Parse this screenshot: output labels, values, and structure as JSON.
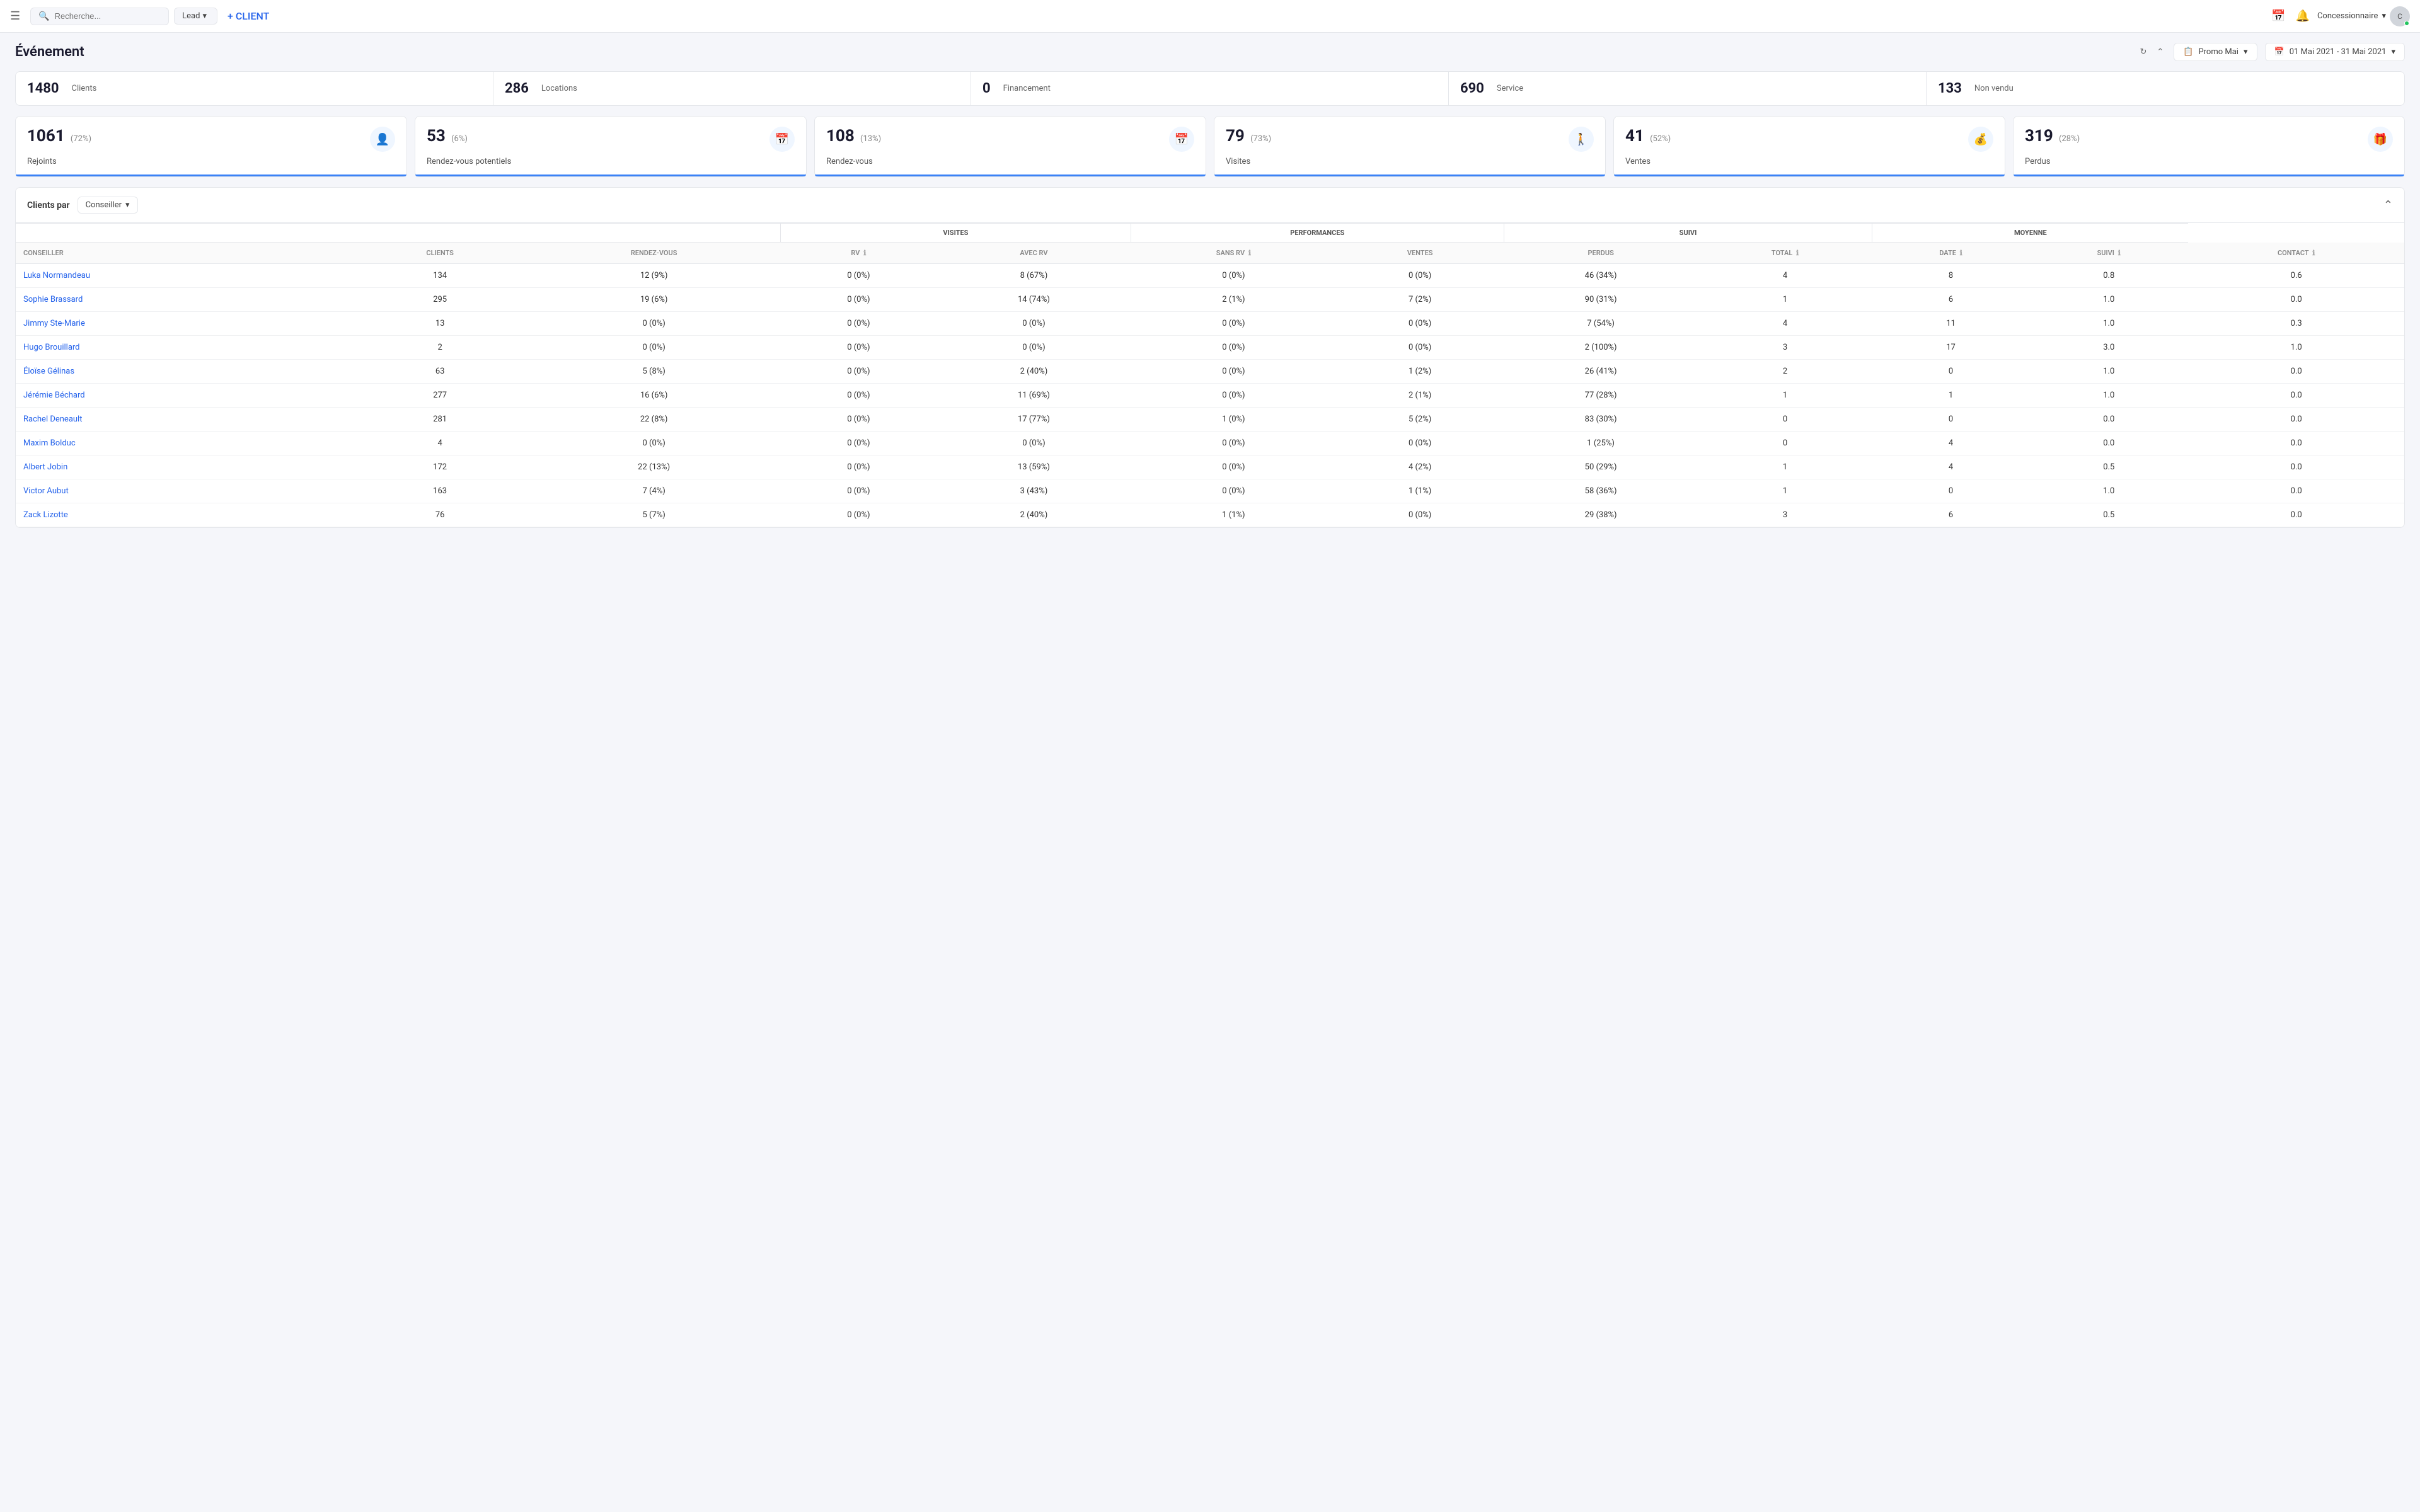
{
  "navbar": {
    "menu_label": "☰",
    "search_placeholder": "Recherche...",
    "lead_label": "Lead",
    "add_client_label": "+ CLIENT",
    "calendar_icon": "📅",
    "bell_icon": "🔔",
    "user_name": "Concessionnaire",
    "avatar_initials": "C"
  },
  "page": {
    "title": "Événement",
    "promo_label": "Promo Mai",
    "date_range": "01 Mai 2021 - 31 Mai 2021"
  },
  "stat_cards": [
    {
      "number": "1480",
      "label": "Clients"
    },
    {
      "number": "286",
      "label": "Locations"
    },
    {
      "number": "0",
      "label": "Financement"
    },
    {
      "number": "690",
      "label": "Service"
    },
    {
      "number": "133",
      "label": "Non vendu"
    }
  ],
  "metric_cards": [
    {
      "value": "1061",
      "pct": "(72%)",
      "label": "Rejoints",
      "icon": "👤"
    },
    {
      "value": "53",
      "pct": "(6%)",
      "label": "Rendez-vous potentiels",
      "icon": "📅"
    },
    {
      "value": "108",
      "pct": "(13%)",
      "label": "Rendez-vous",
      "icon": "📅"
    },
    {
      "value": "79",
      "pct": "(73%)",
      "label": "Visites",
      "icon": "🚶"
    },
    {
      "value": "41",
      "pct": "(52%)",
      "label": "Ventes",
      "icon": "💰"
    },
    {
      "value": "319",
      "pct": "(28%)",
      "label": "Perdus",
      "icon": "🎁"
    }
  ],
  "table": {
    "title": "Clients par",
    "filter_label": "Conseiller",
    "col_groups": [
      {
        "label": "",
        "colspan": 3
      },
      {
        "label": "VISITES",
        "colspan": 2
      },
      {
        "label": "PERFORMANCES",
        "colspan": 2
      },
      {
        "label": "SUIVI",
        "colspan": 2
      },
      {
        "label": "MOYENNE",
        "colspan": 2
      }
    ],
    "columns": [
      "Conseiller",
      "Clients",
      "Rendez-vous",
      "RV",
      "Avec RV",
      "Sans RV",
      "Ventes",
      "Perdus",
      "Total",
      "Date",
      "Suivi",
      "Contact"
    ],
    "rows": [
      {
        "name": "Luka Normandeau",
        "clients": 134,
        "rdv": "12 (9%)",
        "rv": "0 (0%)",
        "avec_rv": "8 (67%)",
        "sans_rv": "0 (0%)",
        "ventes": "0 (0%)",
        "perdus": "46 (34%)",
        "total": 4,
        "date": 8,
        "suivi": "0.8",
        "contact": "0.6"
      },
      {
        "name": "Sophie Brassard",
        "clients": 295,
        "rdv": "19 (6%)",
        "rv": "0 (0%)",
        "avec_rv": "14 (74%)",
        "sans_rv": "2 (1%)",
        "ventes": "7 (2%)",
        "perdus": "90 (31%)",
        "total": 1,
        "date": 6,
        "suivi": "1.0",
        "contact": "0.0"
      },
      {
        "name": "Jimmy Ste-Marie",
        "clients": 13,
        "rdv": "0 (0%)",
        "rv": "0 (0%)",
        "avec_rv": "0 (0%)",
        "sans_rv": "0 (0%)",
        "ventes": "0 (0%)",
        "perdus": "7 (54%)",
        "total": 4,
        "date": 11,
        "suivi": "1.0",
        "contact": "0.3"
      },
      {
        "name": "Hugo Brouillard",
        "clients": 2,
        "rdv": "0 (0%)",
        "rv": "0 (0%)",
        "avec_rv": "0 (0%)",
        "sans_rv": "0 (0%)",
        "ventes": "0 (0%)",
        "perdus": "2 (100%)",
        "total": 3,
        "date": 17,
        "suivi": "3.0",
        "contact": "1.0"
      },
      {
        "name": "Éloïse Gélinas",
        "clients": 63,
        "rdv": "5 (8%)",
        "rv": "0 (0%)",
        "avec_rv": "2 (40%)",
        "sans_rv": "0 (0%)",
        "ventes": "1 (2%)",
        "perdus": "26 (41%)",
        "total": 2,
        "date": 0,
        "suivi": "1.0",
        "contact": "0.0"
      },
      {
        "name": "Jérémie Béchard",
        "clients": 277,
        "rdv": "16 (6%)",
        "rv": "0 (0%)",
        "avec_rv": "11 (69%)",
        "sans_rv": "0 (0%)",
        "ventes": "2 (1%)",
        "perdus": "77 (28%)",
        "total": 1,
        "date": 1,
        "suivi": "1.0",
        "contact": "0.0"
      },
      {
        "name": "Rachel Deneault",
        "clients": 281,
        "rdv": "22 (8%)",
        "rv": "0 (0%)",
        "avec_rv": "17 (77%)",
        "sans_rv": "1 (0%)",
        "ventes": "5 (2%)",
        "perdus": "83 (30%)",
        "total": 0,
        "date": 0,
        "suivi": "0.0",
        "contact": "0.0"
      },
      {
        "name": "Maxim Bolduc",
        "clients": 4,
        "rdv": "0 (0%)",
        "rv": "0 (0%)",
        "avec_rv": "0 (0%)",
        "sans_rv": "0 (0%)",
        "ventes": "0 (0%)",
        "perdus": "1 (25%)",
        "total": 0,
        "date": 4,
        "suivi": "0.0",
        "contact": "0.0"
      },
      {
        "name": "Albert Jobin",
        "clients": 172,
        "rdv": "22 (13%)",
        "rv": "0 (0%)",
        "avec_rv": "13 (59%)",
        "sans_rv": "0 (0%)",
        "ventes": "4 (2%)",
        "perdus": "50 (29%)",
        "total": 1,
        "date": 4,
        "suivi": "0.5",
        "contact": "0.0"
      },
      {
        "name": "Victor Aubut",
        "clients": 163,
        "rdv": "7 (4%)",
        "rv": "0 (0%)",
        "avec_rv": "3 (43%)",
        "sans_rv": "0 (0%)",
        "ventes": "1 (1%)",
        "perdus": "58 (36%)",
        "total": 1,
        "date": 0,
        "suivi": "1.0",
        "contact": "0.0"
      },
      {
        "name": "Zack Lizotte",
        "clients": 76,
        "rdv": "5 (7%)",
        "rv": "0 (0%)",
        "avec_rv": "2 (40%)",
        "sans_rv": "1 (1%)",
        "ventes": "0 (0%)",
        "perdus": "29 (38%)",
        "total": 3,
        "date": 6,
        "suivi": "0.5",
        "contact": "0.0"
      }
    ]
  }
}
